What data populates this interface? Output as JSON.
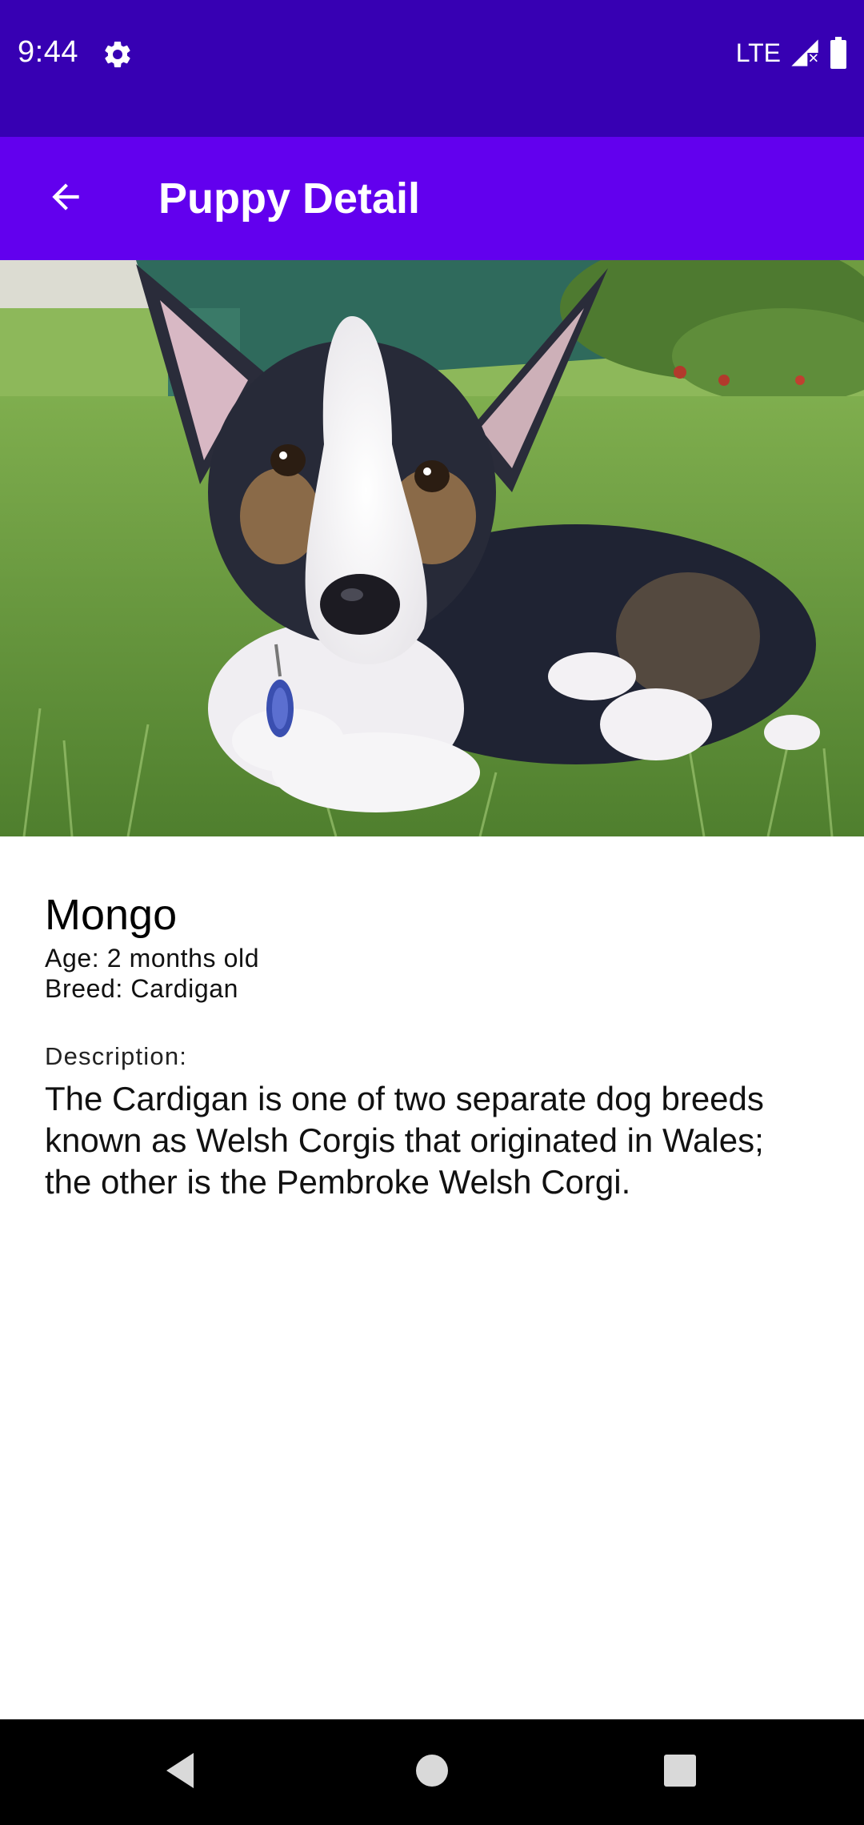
{
  "status_bar": {
    "time": "9:44",
    "network": "LTE",
    "icons": [
      "gear-icon",
      "signal-icon",
      "battery-icon"
    ]
  },
  "app_bar": {
    "title": "Puppy Detail",
    "back_icon": "arrow-back-icon"
  },
  "hero_image": {
    "subject": "Corgi puppy lying on grass"
  },
  "puppy": {
    "name": "Mongo",
    "age": "Age: 2 months old",
    "breed": "Breed: Cardigan",
    "description_label": "Description:",
    "description": "The Cardigan is one of two separate dog breeds known as Welsh Corgis that originated in Wales; the other is the Pembroke Welsh Corgi."
  },
  "nav_bar": {
    "buttons": [
      "back-triangle-icon",
      "home-circle-icon",
      "recents-square-icon"
    ]
  },
  "colors": {
    "status_bar": "#3700b3",
    "app_bar": "#6200ee",
    "nav_bar": "#000000",
    "background": "#ffffff"
  }
}
